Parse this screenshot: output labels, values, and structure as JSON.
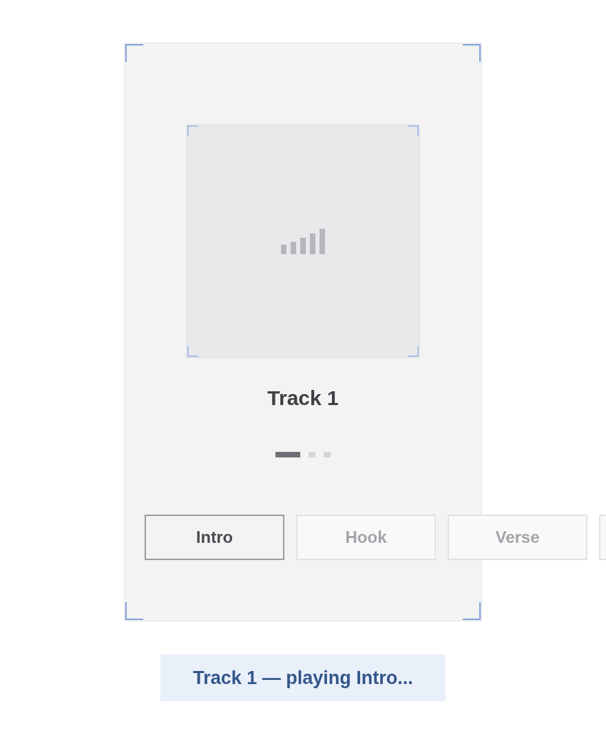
{
  "track": {
    "title": "Track 1"
  },
  "pager": [
    {
      "selected": true
    },
    {
      "selected": false
    },
    {
      "selected": false
    }
  ],
  "sections": [
    {
      "label": "Intro",
      "selected": true
    },
    {
      "label": "Hook",
      "selected": false
    },
    {
      "label": "Verse",
      "selected": false
    },
    {
      "selected": false
    }
  ],
  "status": "Track 1 — playing Intro..."
}
